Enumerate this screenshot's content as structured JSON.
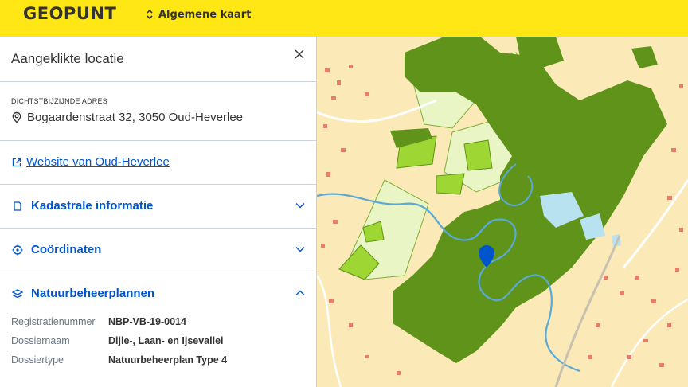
{
  "header": {
    "logo": "GEOPUNT",
    "layer_label": "Algemene kaart"
  },
  "panel": {
    "title": "Aangeklikte locatie",
    "address": {
      "label": "DICHTSTBIJZIJNDE ADRES",
      "value": "Bogaardenstraat 32, 3050 Oud-Heverlee"
    },
    "website_link": "Website van Oud-Heverlee",
    "sections": [
      {
        "label": "Kadastrale informatie",
        "icon": "parcel-icon",
        "open": false
      },
      {
        "label": "Coördinaten",
        "icon": "target-icon",
        "open": false
      },
      {
        "label": "Natuurbeheerplannen",
        "icon": "layers-icon",
        "open": true
      }
    ],
    "nature_plan": [
      {
        "key": "Registratienummer",
        "value": "NBP-VB-19-0014"
      },
      {
        "key": "Dossiernaam",
        "value": "Dijle-, Laan- en Ijsevallei"
      },
      {
        "key": "Dossiertype",
        "value": "Natuurbeheerplan Type 4"
      }
    ]
  },
  "colors": {
    "header_bg": "#ffe615",
    "link": "#0055cc",
    "forest": "#5f9319",
    "meadow_light": "#e9f5c4",
    "meadow_mid": "#9ed633",
    "map_bg": "#fbe9b7",
    "marker": "#0055cc"
  }
}
